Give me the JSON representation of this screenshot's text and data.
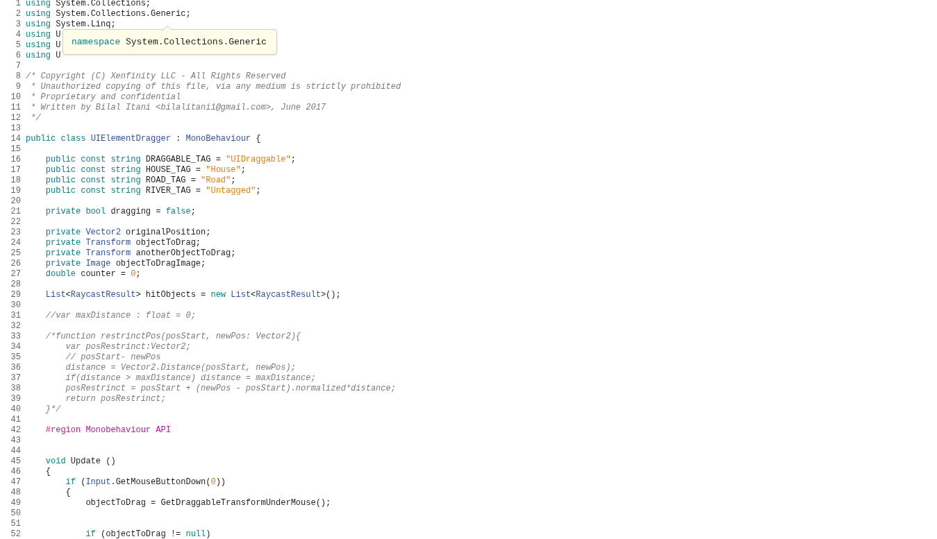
{
  "editor": {
    "lines": [
      {
        "number": "1",
        "tokens": [
          {
            "kind": "keyword",
            "text": "using"
          },
          {
            "kind": "plain",
            "text": " System.Collections;"
          }
        ]
      },
      {
        "number": "2",
        "tokens": [
          {
            "kind": "keyword",
            "text": "using"
          },
          {
            "kind": "plain",
            "text": " System.Collections.Generic;"
          }
        ]
      },
      {
        "number": "3",
        "tokens": [
          {
            "kind": "keyword",
            "text": "using"
          },
          {
            "kind": "plain",
            "text": " System.Linq;"
          }
        ]
      },
      {
        "number": "4",
        "tokens": [
          {
            "kind": "keyword",
            "text": "using"
          },
          {
            "kind": "plain",
            "text": " U"
          }
        ]
      },
      {
        "number": "5",
        "tokens": [
          {
            "kind": "keyword",
            "text": "using"
          },
          {
            "kind": "plain",
            "text": " U"
          }
        ]
      },
      {
        "number": "6",
        "tokens": [
          {
            "kind": "keyword",
            "text": "using"
          },
          {
            "kind": "plain",
            "text": " U"
          }
        ]
      },
      {
        "number": "7"
      },
      {
        "number": "8",
        "tokens": [
          {
            "kind": "comment",
            "text": "/* Copyright (C) Xenfinity LLC - All Rights Reserved"
          }
        ]
      },
      {
        "number": "9",
        "tokens": [
          {
            "kind": "comment",
            "text": " * Unauthorized copying of this file, via any medium is strictly prohibited"
          }
        ]
      },
      {
        "number": "10",
        "tokens": [
          {
            "kind": "comment",
            "text": " * Proprietary and confidential"
          }
        ]
      },
      {
        "number": "11",
        "tokens": [
          {
            "kind": "comment",
            "text": " * Written by Bilal Itani <bilalitani1@gmail.com>, June 2017"
          }
        ]
      },
      {
        "number": "12",
        "tokens": [
          {
            "kind": "comment",
            "text": " */"
          }
        ]
      },
      {
        "number": "13"
      },
      {
        "number": "14",
        "tokens": [
          {
            "kind": "keyword",
            "text": "public class "
          },
          {
            "kind": "type",
            "text": "UIElementDragger"
          },
          {
            "kind": "plain",
            "text": " : "
          },
          {
            "kind": "type",
            "text": "MonoBehaviour"
          },
          {
            "kind": "plain",
            "text": " {"
          }
        ]
      },
      {
        "number": "15"
      },
      {
        "number": "16",
        "tokens": [
          {
            "kind": "keyword",
            "text": "    public const string"
          },
          {
            "kind": "plain",
            "text": " DRAGGABLE_TAG = "
          },
          {
            "kind": "string",
            "text": "\"UIDraggable\""
          },
          {
            "kind": "plain",
            "text": ";"
          }
        ]
      },
      {
        "number": "17",
        "tokens": [
          {
            "kind": "keyword",
            "text": "    public const string"
          },
          {
            "kind": "plain",
            "text": " HOUSE_TAG = "
          },
          {
            "kind": "string",
            "text": "\"House\""
          },
          {
            "kind": "plain",
            "text": ";"
          }
        ]
      },
      {
        "number": "18",
        "tokens": [
          {
            "kind": "keyword",
            "text": "    public const string"
          },
          {
            "kind": "plain",
            "text": " ROAD_TAG = "
          },
          {
            "kind": "string",
            "text": "\"Road\""
          },
          {
            "kind": "plain",
            "text": ";"
          }
        ]
      },
      {
        "number": "19",
        "tokens": [
          {
            "kind": "keyword",
            "text": "    public const string"
          },
          {
            "kind": "plain",
            "text": " RIVER_TAG = "
          },
          {
            "kind": "string",
            "text": "\"Untagged\""
          },
          {
            "kind": "plain",
            "text": ";"
          }
        ]
      },
      {
        "number": "20"
      },
      {
        "number": "21",
        "tokens": [
          {
            "kind": "keyword",
            "text": "    private bool"
          },
          {
            "kind": "plain",
            "text": " dragging = "
          },
          {
            "kind": "keyword",
            "text": "false"
          },
          {
            "kind": "plain",
            "text": ";"
          }
        ]
      },
      {
        "number": "22"
      },
      {
        "number": "23",
        "tokens": [
          {
            "kind": "keyword",
            "text": "    private "
          },
          {
            "kind": "type",
            "text": "Vector2"
          },
          {
            "kind": "plain",
            "text": " originalPosition;"
          }
        ]
      },
      {
        "number": "24",
        "tokens": [
          {
            "kind": "keyword",
            "text": "    private "
          },
          {
            "kind": "type",
            "text": "Transform"
          },
          {
            "kind": "plain",
            "text": " objectToDrag;"
          }
        ]
      },
      {
        "number": "25",
        "tokens": [
          {
            "kind": "keyword",
            "text": "    private "
          },
          {
            "kind": "type",
            "text": "Transform"
          },
          {
            "kind": "plain",
            "text": " anotherObjectToDrag;"
          }
        ]
      },
      {
        "number": "26",
        "tokens": [
          {
            "kind": "keyword",
            "text": "    private "
          },
          {
            "kind": "type",
            "text": "Image"
          },
          {
            "kind": "plain",
            "text": " objectToDragImage;"
          }
        ]
      },
      {
        "number": "27",
        "tokens": [
          {
            "kind": "keyword",
            "text": "    double"
          },
          {
            "kind": "plain",
            "text": " counter = "
          },
          {
            "kind": "number",
            "text": "0"
          },
          {
            "kind": "plain",
            "text": ";"
          }
        ]
      },
      {
        "number": "28"
      },
      {
        "number": "29",
        "tokens": [
          {
            "kind": "type",
            "text": "    List"
          },
          {
            "kind": "plain",
            "text": "<"
          },
          {
            "kind": "type",
            "text": "RaycastResult"
          },
          {
            "kind": "plain",
            "text": "> hitObjects = "
          },
          {
            "kind": "keyword",
            "text": "new "
          },
          {
            "kind": "type",
            "text": "List"
          },
          {
            "kind": "plain",
            "text": "<"
          },
          {
            "kind": "type",
            "text": "RaycastResult"
          },
          {
            "kind": "plain",
            "text": ">();"
          }
        ]
      },
      {
        "number": "30"
      },
      {
        "number": "31",
        "tokens": [
          {
            "kind": "comment",
            "text": "    //var maxDistance : float = 0;"
          }
        ]
      },
      {
        "number": "32"
      },
      {
        "number": "33",
        "tokens": [
          {
            "kind": "comment",
            "text": "    /*function restrinctPos(posStart, newPos: Vector2){"
          }
        ]
      },
      {
        "number": "34",
        "tokens": [
          {
            "kind": "comment",
            "text": "        var posRestrinct:Vector2;"
          }
        ]
      },
      {
        "number": "35",
        "tokens": [
          {
            "kind": "comment",
            "text": "        // posStart- newPos"
          }
        ]
      },
      {
        "number": "36",
        "tokens": [
          {
            "kind": "comment",
            "text": "        distance = Vector2.Distance(posStart, newPos);"
          }
        ]
      },
      {
        "number": "37",
        "tokens": [
          {
            "kind": "comment",
            "text": "        if(distance > maxDistance) distance = maxDistance;"
          }
        ]
      },
      {
        "number": "38",
        "tokens": [
          {
            "kind": "comment",
            "text": "        posRestrinct = posStart + (newPos - posStart).normalized*distance;"
          }
        ]
      },
      {
        "number": "39",
        "tokens": [
          {
            "kind": "comment",
            "text": "        return posRestrinct;"
          }
        ]
      },
      {
        "number": "40",
        "tokens": [
          {
            "kind": "comment",
            "text": "    }*/"
          }
        ]
      },
      {
        "number": "41"
      },
      {
        "number": "42",
        "tokens": [
          {
            "kind": "preprocessor",
            "text": "    #region Monobehaviour API"
          }
        ]
      },
      {
        "number": "43"
      },
      {
        "number": "44"
      },
      {
        "number": "45",
        "tokens": [
          {
            "kind": "keyword",
            "text": "    void"
          },
          {
            "kind": "plain",
            "text": " Update ()"
          }
        ]
      },
      {
        "number": "46",
        "tokens": [
          {
            "kind": "plain",
            "text": "    {"
          }
        ]
      },
      {
        "number": "47",
        "tokens": [
          {
            "kind": "keyword",
            "text": "        if"
          },
          {
            "kind": "plain",
            "text": " ("
          },
          {
            "kind": "type",
            "text": "Input"
          },
          {
            "kind": "plain",
            "text": ".GetMouseButtonDown("
          },
          {
            "kind": "number",
            "text": "0"
          },
          {
            "kind": "plain",
            "text": "))"
          }
        ]
      },
      {
        "number": "48",
        "tokens": [
          {
            "kind": "plain",
            "text": "        {"
          }
        ]
      },
      {
        "number": "49",
        "tokens": [
          {
            "kind": "plain",
            "text": "            objectToDrag = GetDraggableTransformUnderMouse();"
          }
        ]
      },
      {
        "number": "50"
      },
      {
        "number": "51"
      },
      {
        "number": "52",
        "tokens": [
          {
            "kind": "keyword",
            "text": "            if"
          },
          {
            "kind": "plain",
            "text": " (objectToDrag != "
          },
          {
            "kind": "keyword",
            "text": "null"
          },
          {
            "kind": "plain",
            "text": ")"
          }
        ]
      }
    ]
  },
  "tooltip": {
    "tokens": [
      {
        "kind": "keyword",
        "text": "namespace"
      },
      {
        "kind": "plain",
        "text": " System.Collections.Generic"
      }
    ]
  }
}
